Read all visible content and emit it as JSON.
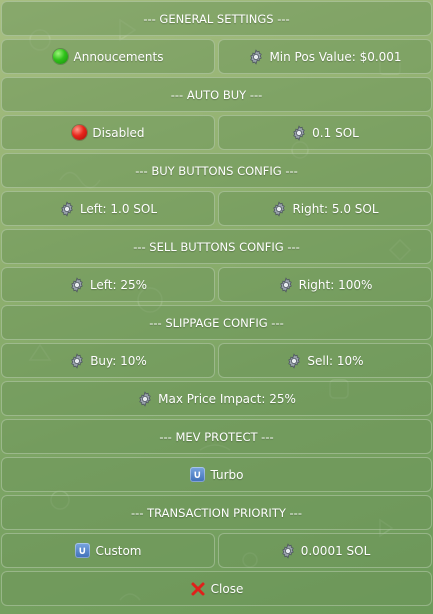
{
  "keyboard": {
    "general_settings": {
      "label": "--- GENERAL SETTINGS ---"
    },
    "announcements": {
      "label": "Annoucements",
      "icon": "green-circle-icon",
      "status_color": "#2fc21a"
    },
    "min_pos_value": {
      "label": "Min Pos Value: $0.001",
      "icon": "gear-icon"
    },
    "auto_buy": {
      "label": "--- AUTO BUY ---"
    },
    "auto_buy_status": {
      "label": "Disabled",
      "icon": "red-circle-icon",
      "status_color": "#e8261b"
    },
    "auto_buy_amount": {
      "label": "0.1 SOL",
      "icon": "gear-icon"
    },
    "buy_buttons_config": {
      "label": "--- BUY BUTTONS CONFIG ---"
    },
    "buy_left": {
      "label": "Left: 1.0 SOL",
      "icon": "gear-icon"
    },
    "buy_right": {
      "label": "Right: 5.0 SOL",
      "icon": "gear-icon"
    },
    "sell_buttons_config": {
      "label": "--- SELL BUTTONS CONFIG ---"
    },
    "sell_left": {
      "label": "Left: 25%",
      "icon": "gear-icon"
    },
    "sell_right": {
      "label": "Right: 100%",
      "icon": "gear-icon"
    },
    "slippage_config": {
      "label": "--- SLIPPAGE CONFIG ---"
    },
    "slippage_buy": {
      "label": "Buy: 10%",
      "icon": "gear-icon"
    },
    "slippage_sell": {
      "label": "Sell: 10%",
      "icon": "gear-icon"
    },
    "max_price_impact": {
      "label": "Max Price Impact: 25%",
      "icon": "gear-icon"
    },
    "mev_protect": {
      "label": "--- MEV PROTECT ---"
    },
    "mev_mode": {
      "label": "Turbo",
      "icon": "u-box-icon",
      "icon_glyph": "∪"
    },
    "transaction_priority": {
      "label": "--- TRANSACTION PRIORITY ---"
    },
    "priority_mode": {
      "label": "Custom",
      "icon": "u-box-icon",
      "icon_glyph": "∪"
    },
    "priority_fee": {
      "label": "0.0001 SOL",
      "icon": "gear-icon"
    },
    "close": {
      "label": "Close",
      "icon": "red-x-icon",
      "color": "#e0201a"
    }
  },
  "theme": {
    "background": "#8fb06f",
    "button_bg": "#7aa163",
    "text_color": "#ffffff"
  }
}
